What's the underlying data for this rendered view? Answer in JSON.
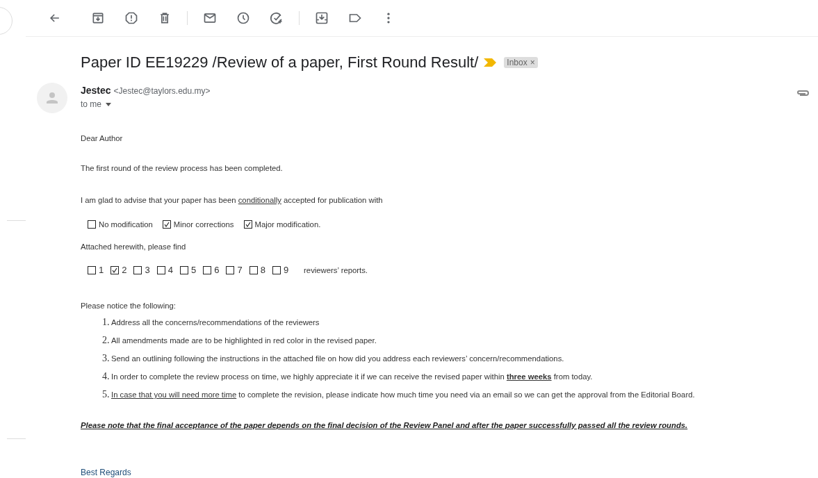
{
  "toolbar": {
    "buttons": [
      {
        "kind": "back"
      },
      {
        "kind": "archive"
      },
      {
        "kind": "spam"
      },
      {
        "kind": "delete"
      },
      {
        "kind": "sep"
      },
      {
        "kind": "unread"
      },
      {
        "kind": "snooze"
      },
      {
        "kind": "task"
      },
      {
        "kind": "sep"
      },
      {
        "kind": "move"
      },
      {
        "kind": "label"
      },
      {
        "kind": "more"
      }
    ]
  },
  "subject": {
    "text": "Paper ID EE19229 /Review of a paper, First Round Result/",
    "important": true,
    "label": "Inbox",
    "label_close": "×"
  },
  "sender": {
    "name": "Jestec",
    "email": "<Jestec@taylors.edu.my>",
    "recipient": "to me",
    "has_attachment": true
  },
  "body": {
    "greeting": "Dear Author",
    "intro": "The first round of the review process has been completed.",
    "decision": [
      {
        "text": "I am glad to advise that your paper has been "
      },
      {
        "text": "conditionally",
        "underline": true
      },
      {
        "text": " accepted for publication with"
      }
    ],
    "outcomes": [
      {
        "label": "No modification",
        "checked": false
      },
      {
        "label": "Minor corrections",
        "checked": true
      },
      {
        "label": "Major modification.",
        "checked": true
      }
    ],
    "attached": "Attached herewith, please find",
    "report_counts": [
      {
        "label": "1",
        "checked": false
      },
      {
        "label": "2",
        "checked": true
      },
      {
        "label": "3",
        "checked": false
      },
      {
        "label": "4",
        "checked": false
      },
      {
        "label": "5",
        "checked": false
      },
      {
        "label": "6",
        "checked": false
      },
      {
        "label": "7",
        "checked": false
      },
      {
        "label": "8",
        "checked": false
      },
      {
        "label": "9",
        "checked": false
      }
    ],
    "reports_suffix": "reviewers’ reports.",
    "notice": "Please notice the following:",
    "items": [
      {
        "number": "1.",
        "parts": [
          {
            "text": "Address all the concerns/recommendations of the reviewers"
          }
        ]
      },
      {
        "number": "2.",
        "parts": [
          {
            "text": "All amendments made are to be highlighted in red color in the revised paper."
          }
        ]
      },
      {
        "number": "3.",
        "parts": [
          {
            "text": "Send an outlining following the instructions in the attached file on how did you address each reviewers’ concern/recommendations."
          }
        ]
      },
      {
        "number": "4.",
        "parts": [
          {
            "text": "In order to complete the review process on time, we highly appreciate it if we can receive the revised paper within "
          },
          {
            "text": "three weeks",
            "underline": true,
            "bold": true
          },
          {
            "text": " from today."
          }
        ]
      },
      {
        "number": "5.",
        "parts": [
          {
            "text": "In case that you will need more time",
            "underline": true
          },
          {
            "text": " to complete the revision, please indicate how much time you need via an email so we can get the approval from the Editorial Board."
          }
        ]
      }
    ],
    "note": "Please note that the final acceptance of the paper depends on the final decision of the Review Panel and after the paper successfully passed all the review rounds.",
    "closing": "Best Regards"
  }
}
